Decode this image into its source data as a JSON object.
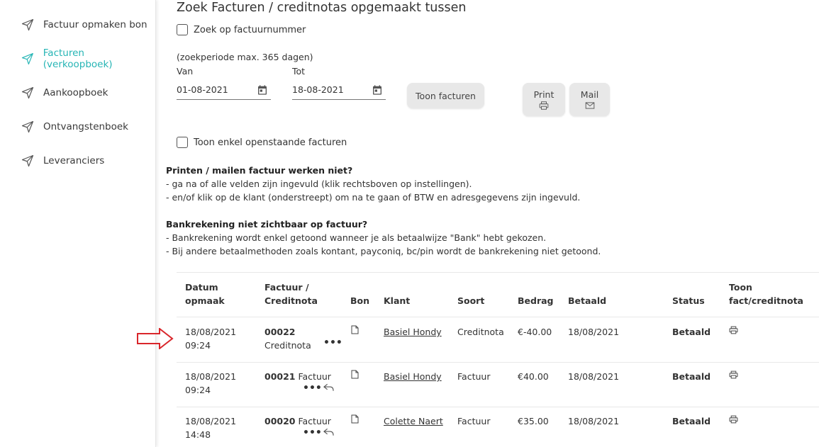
{
  "sidebar": {
    "items": [
      {
        "label": "Factuur opmaken bon",
        "active": false
      },
      {
        "label": "Facturen (verkoopboek)",
        "active": true
      },
      {
        "label": "Aankoopboek",
        "active": false
      },
      {
        "label": "Ontvangstenboek",
        "active": false
      },
      {
        "label": "Leveranciers",
        "active": false
      }
    ],
    "icon": "send-icon",
    "active_color": "#26b5b5"
  },
  "main": {
    "title": "Zoek Facturen / creditnotas opgemaakt tussen",
    "search_by_number_label": "Zoek op factuurnummer",
    "period_note": "(zoekperiode max. 365 dagen)",
    "from_label": "Van",
    "to_label": "Tot",
    "from_value": "01-08-2021",
    "to_value": "18-08-2021",
    "show_button": "Toon facturen",
    "print_button": "Print",
    "mail_button": "Mail",
    "open_only_label": "Toon enkel openstaande facturen",
    "info1_title": "Printen / mailen factuur werken niet?",
    "info1_line1": "- ga na of alle velden zijn ingevuld (klik rechtsboven op instellingen).",
    "info1_line2": "- en/of klik op de klant (onderstreept) om na te gaan of BTW en adresgegevens zijn ingevuld.",
    "info2_title": "Bankrekening niet zichtbaar op factuur?",
    "info2_line1": "- Bankrekening wordt enkel getoond wanneer je als betaalwijze \"Bank\" hebt gekozen.",
    "info2_line2": "- Bij andere betaalmethoden zoals kontant, payconiq, bc/pin wordt de bankrekening niet getoond."
  },
  "table": {
    "headers": {
      "datum1": "Datum",
      "datum2": "opmaak",
      "factuur1": "Factuur /",
      "factuur2": "Creditnota",
      "bon": "Bon",
      "klant": "Klant",
      "soort": "Soort",
      "bedrag": "Bedrag",
      "betaald": "Betaald",
      "status": "Status",
      "toon1": "Toon",
      "toon2": "fact/creditnota"
    },
    "rows": [
      {
        "date": "18/08/2021",
        "time": "09:24",
        "number": "00022",
        "type_label": "Creditnota",
        "klant": "Basiel Hondy",
        "soort": "Creditnota",
        "bedrag": "€-40.00",
        "betaald": "18/08/2021",
        "status": "Betaald"
      },
      {
        "date": "18/08/2021",
        "time": "09:24",
        "number": "00021",
        "type_label": "Factuur",
        "klant": "Basiel Hondy",
        "soort": "Factuur",
        "bedrag": "€40.00",
        "betaald": "18/08/2021",
        "status": "Betaald"
      },
      {
        "date": "18/08/2021",
        "time": "14:48",
        "number": "00020",
        "type_label": "Factuur",
        "klant": "Colette Naert",
        "soort": "Factuur",
        "bedrag": "€35.00",
        "betaald": "18/08/2021",
        "status": "Betaald"
      }
    ]
  },
  "annotation_color": "#d9262b"
}
